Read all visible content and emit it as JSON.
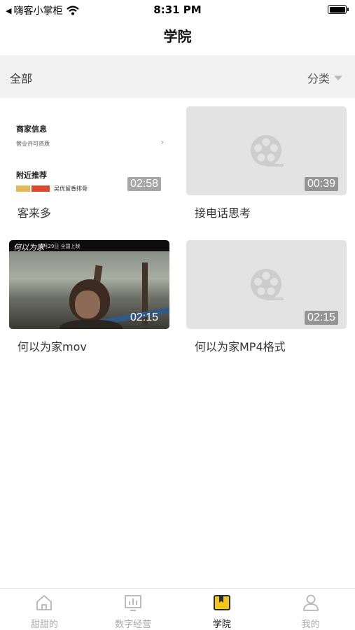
{
  "status_bar": {
    "back_app": "嗨客小掌柜",
    "time": "8:31 PM"
  },
  "nav": {
    "title": "学院"
  },
  "filter": {
    "all_label": "全部",
    "category_label": "分类"
  },
  "videos": [
    {
      "title": "客来多",
      "duration": "02:58",
      "thumb_type": "merchant",
      "thumb_text": {
        "line1": "商家信息",
        "line2": "营业许可资质",
        "line3": "附近推荐",
        "line4": "吴优留香排骨"
      }
    },
    {
      "title": "接电话思考",
      "duration": "00:39",
      "thumb_type": "placeholder"
    },
    {
      "title": "何以为家mov",
      "duration": "02:15",
      "thumb_type": "movie",
      "thumb_text": {
        "logo": "何以为家",
        "date": "4月29日 全国上映"
      }
    },
    {
      "title": "何以为家MP4格式",
      "duration": "02:15",
      "thumb_type": "placeholder"
    }
  ],
  "tabs": [
    {
      "label": "甜甜的",
      "icon": "home-icon",
      "active": false
    },
    {
      "label": "数字经营",
      "icon": "chart-icon",
      "active": false
    },
    {
      "label": "学院",
      "icon": "book-icon",
      "active": true
    },
    {
      "label": "我的",
      "icon": "user-icon",
      "active": false
    }
  ],
  "colors": {
    "accent": "#f5c518",
    "filter_bg": "#f2f2f2",
    "placeholder_bg": "#e3e3e3",
    "inactive_tab": "#aaaaaa"
  }
}
